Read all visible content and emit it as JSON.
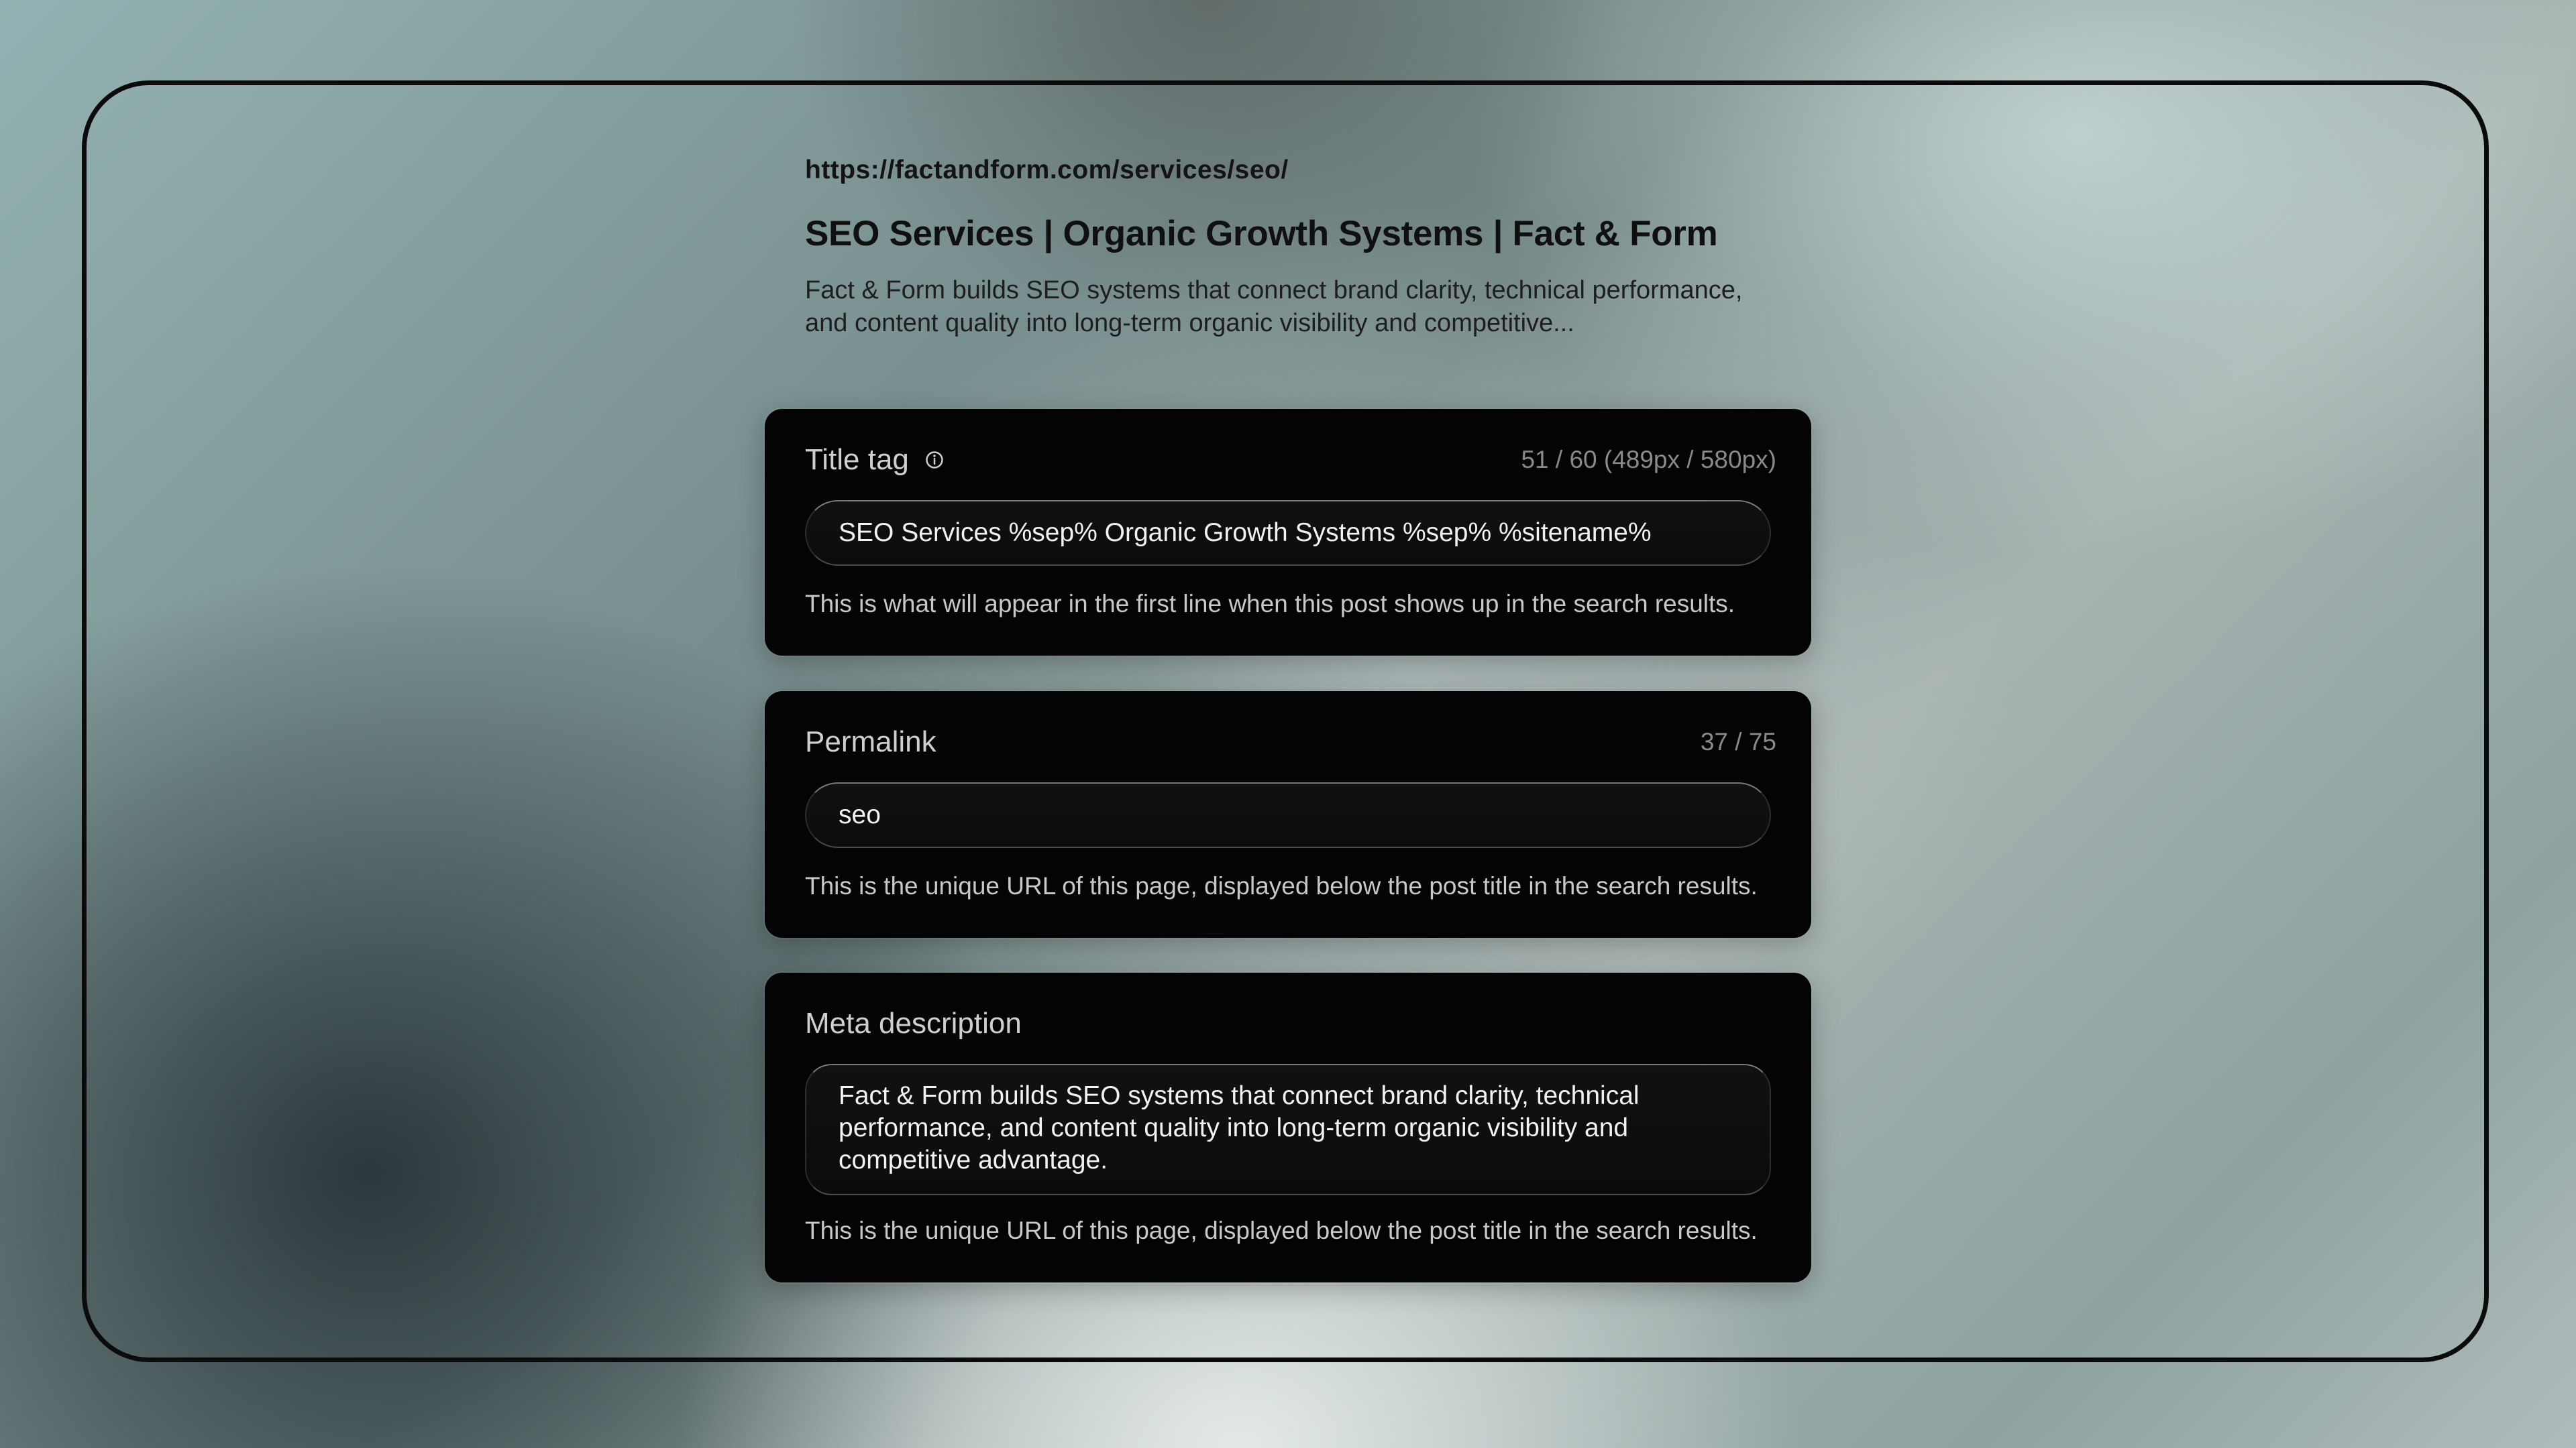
{
  "preview": {
    "url": "https://factandform.com/services/seo/",
    "title": "SEO Services | Organic Growth Systems | Fact & Form",
    "description": "Fact & Form builds SEO systems that connect brand clarity, technical performance, and content quality into long-term organic visibility and competitive..."
  },
  "title_tag": {
    "label": "Title tag",
    "info_icon": "info-icon",
    "counter": "51 / 60 (489px / 580px)",
    "value": "SEO Services %sep% Organic Growth Systems %sep% %sitename%",
    "help": "This is what will appear in the first line when this post shows up in the search results."
  },
  "permalink": {
    "label": "Permalink",
    "counter": "37 / 75",
    "value": "seo",
    "help": "This is the unique URL of this page, displayed below the post title in the search results."
  },
  "meta_description": {
    "label": "Meta description",
    "value": "Fact & Form builds SEO systems that connect brand clarity, technical performance, and content quality into long-term organic visibility and competitive advantage.",
    "help": "This is the unique URL of this page, displayed below the post title in the search results."
  },
  "colors": {
    "card_background": "#040404",
    "frame_border": "#0b0b0b",
    "label_text": "#cfcfcf",
    "counter_text": "#8a8a8a"
  }
}
